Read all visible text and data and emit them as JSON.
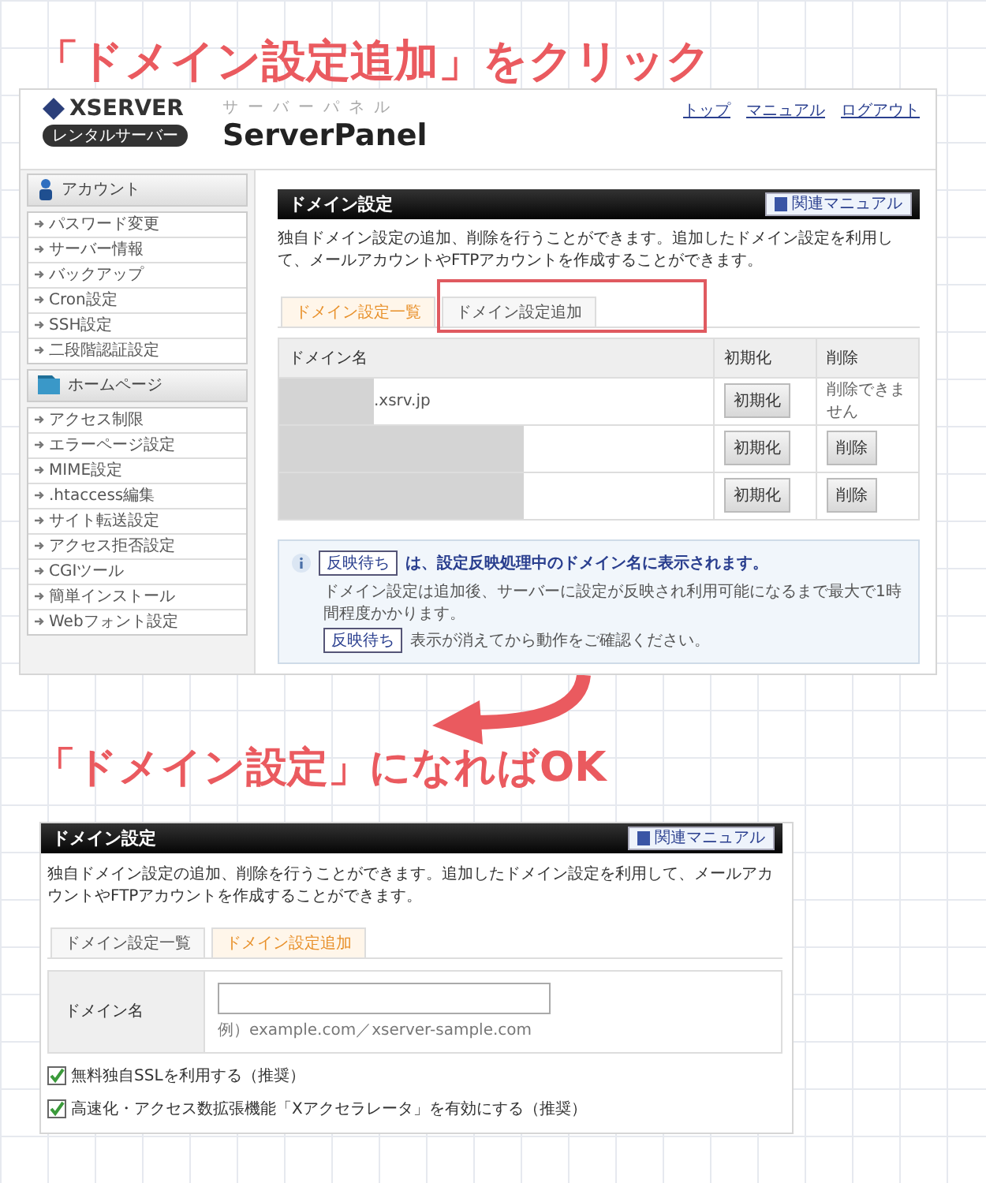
{
  "top_caption": "「ドメイン設定追加」をクリック",
  "top_screen": {
    "header": {
      "logo": "XSERVER",
      "logo_badge": "レンタルサーバー",
      "product_kana": "サーバーパネル",
      "product": "ServerPanel",
      "nav_links": [
        "トップ",
        "マニュアル",
        "ログアウト"
      ]
    },
    "sidebar": [
      {
        "kind": "account",
        "title": "アカウント",
        "items": [
          "パスワード変更",
          "サーバー情報",
          "バックアップ",
          "Cron設定",
          "SSH設定",
          "二段階認証設定"
        ]
      },
      {
        "kind": "homepage",
        "title": "ホームページ",
        "items": [
          "アクセス制限",
          "エラーページ設定",
          "MIME設定",
          ".htaccess編集",
          "サイト転送設定",
          "アクセス拒否設定",
          "CGIツール",
          "簡単インストール",
          "Webフォント設定"
        ]
      }
    ],
    "panel": {
      "title": "ドメイン設定",
      "manual_button": "関連マニュアル",
      "description": "独自ドメイン設定の追加、削除を行うことができます。追加したドメイン設定を利用して、メールアカウントやFTPアカウントを作成することができます。",
      "tabs": [
        {
          "label": "ドメイン設定一覧",
          "selected": true,
          "highlighted": false
        },
        {
          "label": "ドメイン設定追加",
          "selected": false,
          "highlighted": true
        }
      ],
      "table": {
        "columns": [
          "ドメイン名",
          "初期化",
          "削除"
        ],
        "rows": [
          {
            "domain": ".xsrv.jp",
            "redacted": true,
            "reset": "初期化",
            "delete": {
              "kind": "text",
              "label": "削除できません"
            }
          },
          {
            "redacted": true,
            "reset": "初期化",
            "delete": {
              "kind": "button",
              "label": "削除"
            }
          },
          {
            "redacted": true,
            "reset": "初期化",
            "delete": {
              "kind": "button",
              "label": "削除"
            }
          }
        ]
      },
      "info": {
        "badge": "反映待ち",
        "headline": "は、設定反映処理中のドメイン名に表示されます。",
        "note": "ドメイン設定は追加後、サーバーに設定が反映され利用可能になるまで最大で1時間程度かかります。",
        "badge_2": "反映待ち",
        "note_2": "表示が消えてから動作をご確認ください。"
      }
    }
  },
  "bottom_caption": "「ドメイン設定」になればOK",
  "bottom_screen": {
    "title": "ドメイン設定",
    "manual_button": "関連マニュアル",
    "description": "独自ドメイン設定の追加、削除を行うことができます。追加したドメイン設定を利用して、メールアカウントやFTPアカウントを作成することができます。",
    "tabs": [
      {
        "label": "ドメイン設定一覧",
        "selected": false
      },
      {
        "label": "ドメイン設定追加",
        "selected": true
      }
    ],
    "form": {
      "label": "ドメイン名",
      "hint": "例）example.com／xserver-sample.com"
    },
    "options": [
      {
        "label": "無料独自SSLを利用する（推奨）",
        "checked": true
      },
      {
        "label": "高速化・アクセス数拡張機能「Xアクセラレータ」を有効にする（推奨）",
        "checked": true
      }
    ]
  }
}
